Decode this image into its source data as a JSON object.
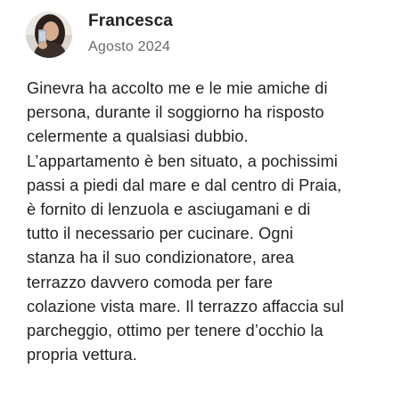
{
  "review": {
    "reviewer_name": "Francesca",
    "avatar_icon": "user-photo-avatar",
    "date": "Agosto 2024",
    "text": "Ginevra ha accolto me e le mie amiche di\npersona, durante il soggiorno ha risposto\ncelermente a qualsiasi dubbio.\nL’appartamento è ben situato, a pochissimi\npassi a piedi dal mare e dal centro di Praia,\nè fornito di lenzuola e asciugamani e di\ntutto il necessario per cucinare. Ogni\nstanza ha il suo condizionatore, area\nterrazzo davvero comoda per fare\ncolazione vista mare. Il terrazzo affaccia sul\nparcheggio, ottimo per tenere d’occhio la\npropria vettura."
  }
}
